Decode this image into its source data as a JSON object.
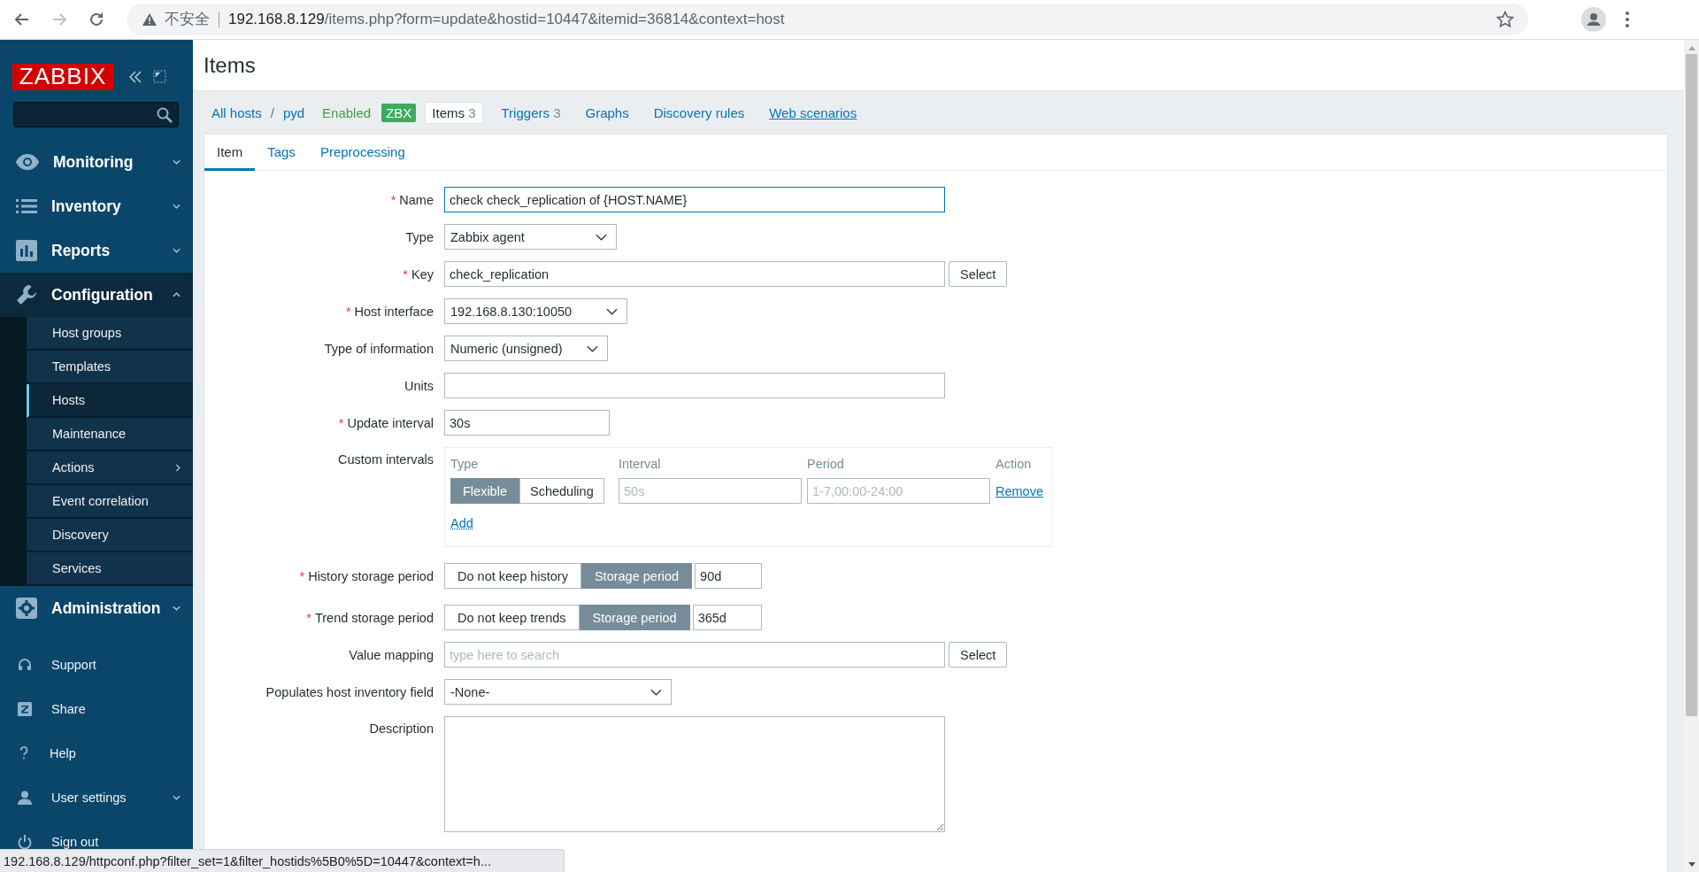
{
  "browser": {
    "security_label": "不安全",
    "url_host": "192.168.8.129",
    "url_path": "/items.php?form=update&hostid=10447&itemid=36814&context=host"
  },
  "sidebar": {
    "logo": "ZABBIX",
    "menu": [
      {
        "label": "Monitoring",
        "expanded": false
      },
      {
        "label": "Inventory",
        "expanded": false
      },
      {
        "label": "Reports",
        "expanded": false
      },
      {
        "label": "Configuration",
        "expanded": true,
        "children": [
          {
            "label": "Host groups",
            "selected": false,
            "has_submenu": false
          },
          {
            "label": "Templates",
            "selected": false,
            "has_submenu": false
          },
          {
            "label": "Hosts",
            "selected": true,
            "has_submenu": false
          },
          {
            "label": "Maintenance",
            "selected": false,
            "has_submenu": false
          },
          {
            "label": "Actions",
            "selected": false,
            "has_submenu": true
          },
          {
            "label": "Event correlation",
            "selected": false,
            "has_submenu": false
          },
          {
            "label": "Discovery",
            "selected": false,
            "has_submenu": false
          },
          {
            "label": "Services",
            "selected": false,
            "has_submenu": false
          }
        ]
      },
      {
        "label": "Administration",
        "expanded": false
      }
    ],
    "footer": [
      {
        "label": "Support",
        "has_submenu": false
      },
      {
        "label": "Share",
        "has_submenu": false
      },
      {
        "label": "Help",
        "has_submenu": false
      },
      {
        "label": "User settings",
        "has_submenu": true
      },
      {
        "label": "Sign out",
        "has_submenu": false
      }
    ]
  },
  "page_title": "Items",
  "host_nav": {
    "breadcrumbs": [
      "All hosts",
      "pyd"
    ],
    "separator": "/",
    "status": "Enabled",
    "badge": "ZBX",
    "links": [
      {
        "label": "Items",
        "count": "3",
        "selected": true,
        "hovered": false
      },
      {
        "label": "Triggers",
        "count": "3",
        "selected": false,
        "hovered": false
      },
      {
        "label": "Graphs",
        "selected": false,
        "hovered": false
      },
      {
        "label": "Discovery rules",
        "selected": false,
        "hovered": false
      },
      {
        "label": "Web scenarios",
        "selected": false,
        "hovered": true
      }
    ]
  },
  "tabs": [
    {
      "label": "Item",
      "selected": true
    },
    {
      "label": "Tags",
      "selected": false
    },
    {
      "label": "Preprocessing",
      "selected": false
    }
  ],
  "form": {
    "required_mark": "*",
    "rows": [
      {
        "label": "Name",
        "required": true,
        "kind": "text",
        "value": "check check_replication of {HOST.NAME}",
        "focused": true
      },
      {
        "label": "Type",
        "required": false,
        "kind": "select",
        "value": "Zabbix agent"
      },
      {
        "label": "Key",
        "required": true,
        "kind": "text",
        "value": "check_replication",
        "focused": false,
        "button": "Select"
      },
      {
        "label": "Host interface",
        "required": true,
        "kind": "select",
        "value": "192.168.8.130:10050"
      },
      {
        "label": "Type of information",
        "required": false,
        "kind": "select",
        "value": "Numeric (unsigned)"
      },
      {
        "label": "Units",
        "required": false,
        "kind": "text",
        "focused": false
      },
      {
        "label": "Update interval",
        "required": true,
        "kind": "text",
        "value": "30s",
        "focused": false
      },
      {
        "label": "Custom intervals",
        "required": false,
        "kind": "intervals",
        "columns": [
          "Type",
          "Interval",
          "Period",
          "Action"
        ],
        "rows": [
          {
            "options": [
              {
                "label": "Flexible",
                "selected": true
              },
              {
                "label": "Scheduling",
                "selected": false
              }
            ],
            "interval_placeholder": "50s",
            "period_placeholder": "1-7,00:00-24:00",
            "action": "Remove"
          }
        ],
        "add": "Add"
      },
      {
        "label": "History storage period",
        "required": true,
        "kind": "segmented",
        "options": [
          {
            "label": "Do not keep history",
            "selected": false
          },
          {
            "label": "Storage period",
            "selected": true
          }
        ],
        "value": "90d"
      },
      {
        "label": "Trend storage period",
        "required": true,
        "kind": "segmented",
        "options": [
          {
            "label": "Do not keep trends",
            "selected": false
          },
          {
            "label": "Storage period",
            "selected": true
          }
        ],
        "value": "365d"
      },
      {
        "label": "Value mapping",
        "required": false,
        "kind": "text",
        "placeholder": "type here to search",
        "focused": false,
        "button": "Select"
      },
      {
        "label": "Populates host inventory field",
        "required": false,
        "kind": "select",
        "value": "-None-"
      },
      {
        "label": "Description",
        "required": false,
        "kind": "textarea"
      }
    ]
  },
  "status_link": "192.168.8.129/httpconf.php?filter_set=1&filter_hostids%5B0%5D=10447&context=h..."
}
